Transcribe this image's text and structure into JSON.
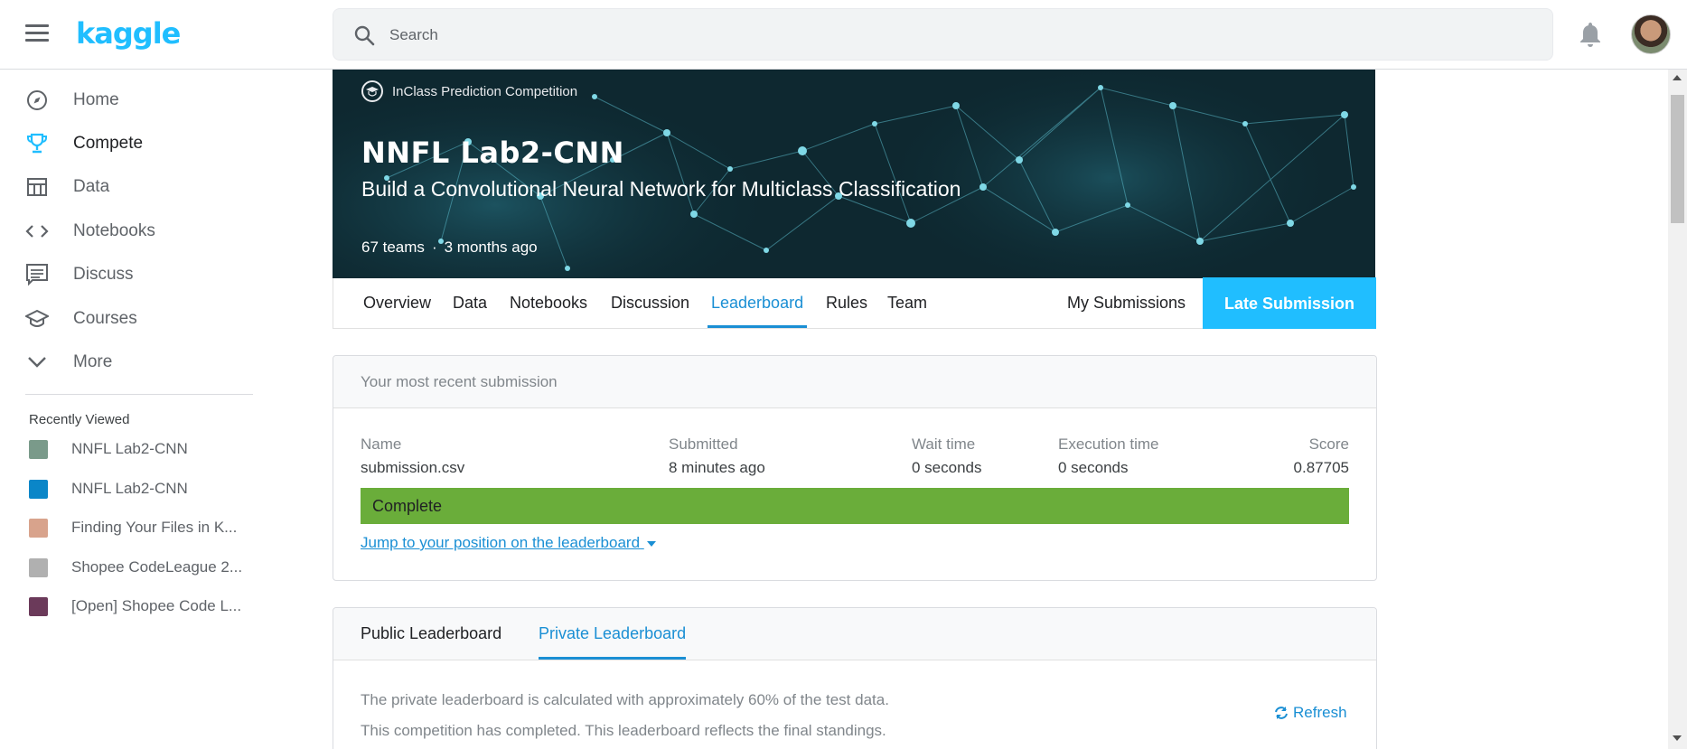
{
  "topbar": {
    "logo": "kaggle",
    "search_placeholder": "Search"
  },
  "sidebar": {
    "items": [
      {
        "label": "Home",
        "icon": "compass-icon"
      },
      {
        "label": "Compete",
        "icon": "trophy-icon"
      },
      {
        "label": "Data",
        "icon": "table-icon"
      },
      {
        "label": "Notebooks",
        "icon": "code-icon"
      },
      {
        "label": "Discuss",
        "icon": "comment-icon"
      },
      {
        "label": "Courses",
        "icon": "graduation-cap-icon"
      },
      {
        "label": "More",
        "icon": "chevron-down-icon"
      }
    ],
    "recently_viewed_title": "Recently Viewed",
    "recently_viewed": [
      {
        "label": "NNFL Lab2-CNN",
        "color": "#7a9a8a"
      },
      {
        "label": "NNFL Lab2-CNN",
        "color": "#0a86c8"
      },
      {
        "label": "Finding Your Files in K...",
        "color": "#d8a38c"
      },
      {
        "label": "Shopee CodeLeague 2...",
        "color": "#b0b0b0"
      },
      {
        "label": "[Open] Shopee Code L...",
        "color": "#6b3a5a"
      }
    ]
  },
  "competition": {
    "type": "InClass Prediction Competition",
    "title": "NNFL Lab2-CNN",
    "subtitle": "Build a Convolutional Neural Network for Multiclass Classification",
    "teams": "67 teams",
    "dot": "·",
    "age": "3 months ago",
    "tabs": [
      "Overview",
      "Data",
      "Notebooks",
      "Discussion",
      "Leaderboard",
      "Rules",
      "Team"
    ],
    "my_submissions": "My Submissions",
    "late_submission": "Late Submission"
  },
  "submission": {
    "header": "Your most recent submission",
    "name_label": "Name",
    "name": "submission.csv",
    "submitted_label": "Submitted",
    "submitted": "8 minutes ago",
    "wait_label": "Wait time",
    "wait": "0 seconds",
    "exec_label": "Execution time",
    "exec": "0 seconds",
    "score_label": "Score",
    "score": "0.87705",
    "status": "Complete",
    "jump_link": "Jump to your position on the leaderboard"
  },
  "leaderboard": {
    "tabs": [
      "Public Leaderboard",
      "Private Leaderboard"
    ],
    "note1": "The private leaderboard is calculated with approximately 60% of the test data.",
    "note2": "This competition has completed. This leaderboard reflects the final standings.",
    "refresh": "Refresh"
  },
  "colors": {
    "accent": "#20beff",
    "link": "#1a8fd4",
    "complete": "#6aad3a"
  }
}
